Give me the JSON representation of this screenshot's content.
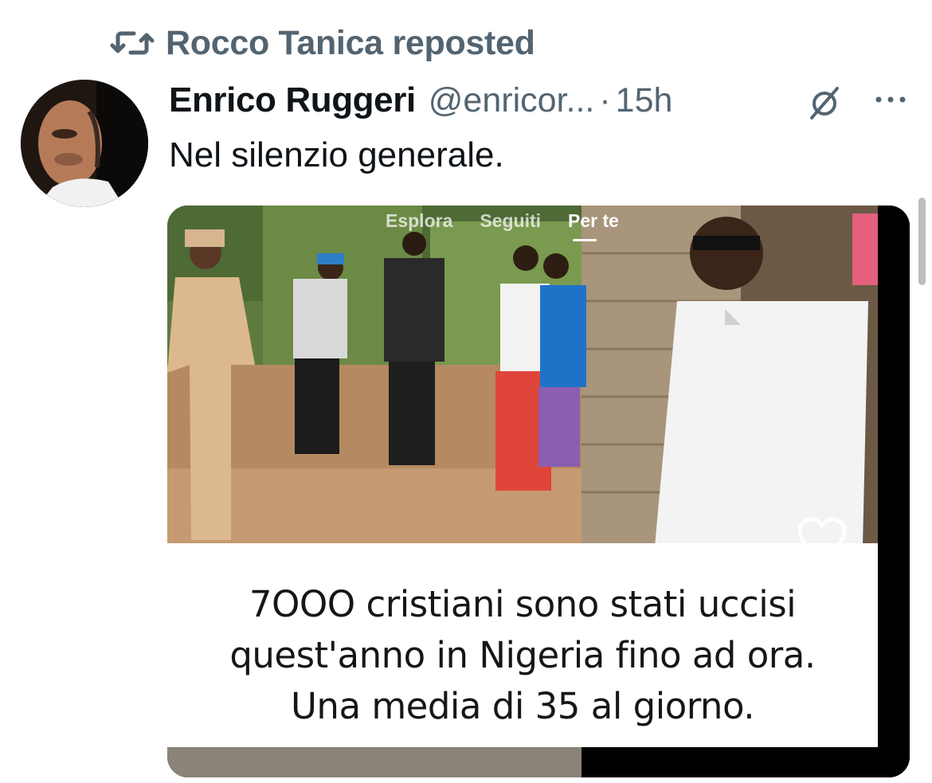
{
  "repost": {
    "icon": "repost-icon",
    "text": "Rocco Tanica reposted"
  },
  "tweet": {
    "author": {
      "display_name": "Enrico Ruggeri",
      "handle": "@enricor...",
      "avatar": "avatar"
    },
    "separator": "·",
    "time": "15h",
    "text": "Nel silenzio generale.",
    "icons": [
      "mute-icon",
      "more-icon"
    ]
  },
  "media": {
    "tiktok_tabs": [
      {
        "label": "Esplora",
        "active": false
      },
      {
        "label": "Seguiti",
        "active": false
      },
      {
        "label": "Per te",
        "active": true
      }
    ],
    "caption_lines": [
      "7OOO cristiani sono stati uccisi",
      "quest'anno in Nigeria fino ad ora.",
      "Una media di 35 al giorno."
    ],
    "icons": [
      "heart-icon"
    ]
  },
  "colors": {
    "text_primary": "#0f1419",
    "text_secondary": "#536471",
    "background": "#ffffff"
  }
}
